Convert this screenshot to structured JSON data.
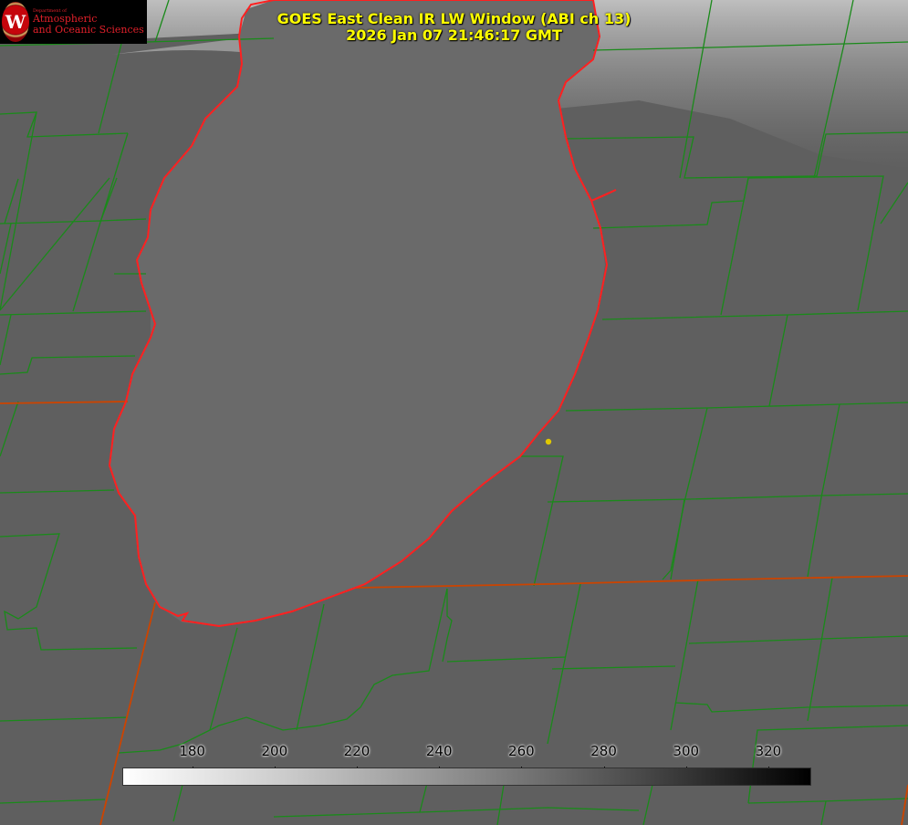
{
  "header": {
    "title_line1": "GOES East Clean IR LW Window (ABI ch 13)",
    "title_line2": "2026 Jan 07 21:46:17 GMT"
  },
  "logo": {
    "line1": "Department of",
    "line2": "Atmospheric",
    "line3": "and Oceanic Sciences",
    "seal_letter": "W"
  },
  "colorbar": {
    "ticks": [
      "180",
      "200",
      "220",
      "240",
      "260",
      "280",
      "300",
      "320"
    ],
    "min_value": 163,
    "max_value": 330,
    "gradient_start": "#ffffff",
    "gradient_end": "#000000"
  },
  "colors": {
    "background": "#5f5f5f",
    "lake": "#6a6a6a",
    "cloud": "#b5b5b5",
    "county_lines": "#1a8a1a",
    "state_lines": "#cc4400",
    "shoreline": "#ff2020",
    "title": "#ffff00",
    "marker": "#e0c800"
  }
}
